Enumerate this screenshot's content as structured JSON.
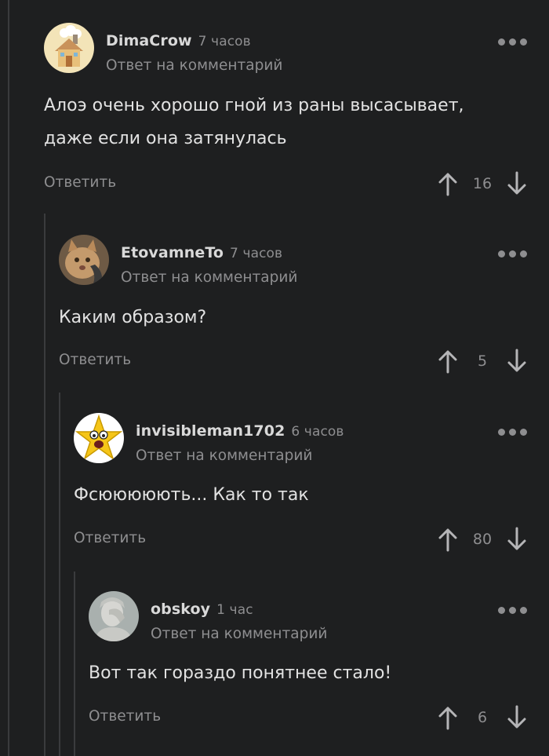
{
  "comments": [
    {
      "author": "DimaCrow",
      "time": "7 часов",
      "reply_label": "Ответ на комментарий",
      "text_lines": [
        "Алоэ очень хорошо гной из раны высасывает,",
        "даже если она затянулась"
      ],
      "reply_button": "Ответить",
      "rating": "16",
      "avatar_icon": "house-avatar"
    },
    {
      "author": "EtovamneTo",
      "time": "7 часов",
      "reply_label": "Ответ на комментарий",
      "text_lines": [
        "Каким образом?"
      ],
      "reply_button": "Ответить",
      "rating": "5",
      "avatar_icon": "cat-avatar"
    },
    {
      "author": "invisibleman1702",
      "time": "6 часов",
      "reply_label": "Ответ на комментарий",
      "text_lines": [
        "Фсююююють... Как то так"
      ],
      "reply_button": "Ответить",
      "rating": "80",
      "avatar_icon": "star-face-avatar"
    },
    {
      "author": "obskoy",
      "time": "1 час",
      "reply_label": "Ответ на комментарий",
      "text_lines": [
        "Вот так гораздо понятнее стало!"
      ],
      "reply_button": "Ответить",
      "rating": "6",
      "avatar_icon": "facepalm-statue-avatar"
    }
  ],
  "colors": {
    "background": "#1e1f20",
    "text": "#e2e2e2",
    "muted": "#8e8e90",
    "thread_line": "#3a3b3d"
  }
}
